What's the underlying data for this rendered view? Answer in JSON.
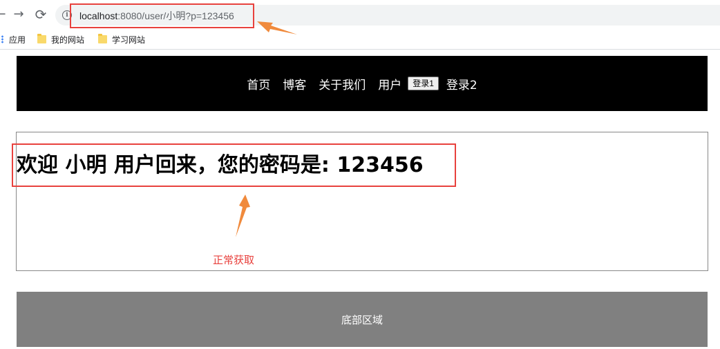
{
  "browser": {
    "back_glyph": "←",
    "forward_glyph": "→",
    "reload_glyph": "⟳",
    "url_host": "localhost",
    "url_rest": ":8080/user/小明?p=123456",
    "bookmarks": [
      {
        "label": "应用",
        "icon": "apps-grid-icon"
      },
      {
        "label": "我的网站",
        "icon": "folder-icon"
      },
      {
        "label": "学习网站",
        "icon": "folder-icon"
      }
    ]
  },
  "header": {
    "nav": [
      "首页",
      "博客",
      "关于我们",
      "用户"
    ],
    "login1_label": "登录1",
    "login2_label": "登录2"
  },
  "main": {
    "welcome_text": "欢迎 小明 用户回来，您的密码是: 123456"
  },
  "footer": {
    "text": "底部区域"
  },
  "annotations": {
    "note_text": "正常获取",
    "color": "#e8413d",
    "arrow_color": "#f08a3c"
  }
}
